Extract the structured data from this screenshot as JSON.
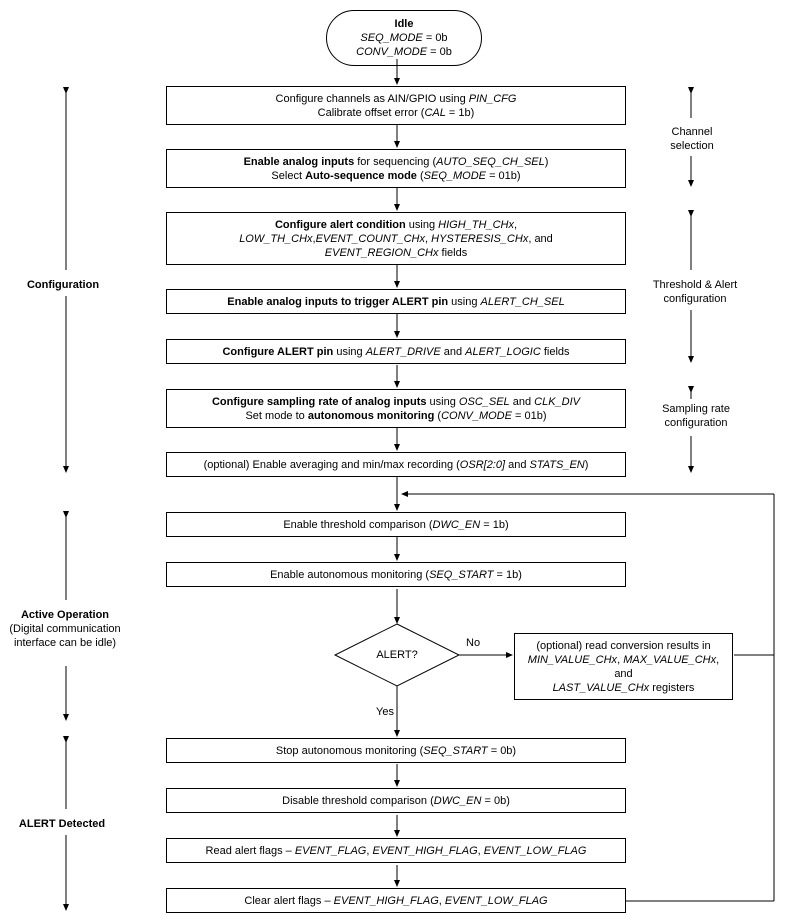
{
  "idle": {
    "title": "Idle",
    "l1": "SEQ_MODE",
    "l2": "CONV_MODE",
    "eq": " = 0b"
  },
  "box1": {
    "t1a": "Configure channels as AIN/GPIO using ",
    "t1b": "PIN_CFG",
    "t2a": "Calibrate offset error (",
    "t2b": "CAL",
    "t2c": " = 1b)"
  },
  "box2": {
    "t1a": "Enable analog inputs",
    "t1b": " for sequencing (",
    "t1c": "AUTO_SEQ_CH_SEL",
    "t1d": ")",
    "t2a": "Select ",
    "t2b": "Auto-sequence mode",
    "t2c": " (",
    "t2d": "SEQ_MODE",
    "t2e": " = 01b)"
  },
  "box3": {
    "t1a": "Configure alert condition",
    "t1b": " using ",
    "t1c": "HIGH_TH_CHx",
    "t1d": ",",
    "t2a": "LOW_TH_CHx",
    "t2b": ",",
    "t2c": "EVENT_COUNT_CHx",
    "t2d": ", ",
    "t2e": "HYSTERESIS_CHx",
    "t2f": ", and",
    "t3a": "EVENT_REGION_CHx",
    "t3b": " fields"
  },
  "box4": {
    "t1a": "Enable analog inputs to trigger ALERT pin",
    "t1b": " using ",
    "t1c": "ALERT_CH_SEL"
  },
  "box5": {
    "t1a": "Configure ALERT pin",
    "t1b": " using ",
    "t1c": "ALERT_DRIVE",
    "t1d": " and ",
    "t1e": "ALERT_LOGIC",
    "t1f": " fields"
  },
  "box6": {
    "t1a": "Configure sampling rate of analog inputs",
    "t1b": " using ",
    "t1c": "OSC_SEL",
    "t1d": " and ",
    "t1e": "CLK_DIV",
    "t2a": "Set mode to ",
    "t2b": "autonomous monitoring",
    "t2c": " (",
    "t2d": "CONV_MODE",
    "t2e": " = 01b)"
  },
  "box7": {
    "t1a": "(optional) Enable averaging and min/max recording (",
    "t1b": "OSR[2:0]",
    "t1c": " and ",
    "t1d": "STATS_EN",
    "t1e": ")"
  },
  "box8": {
    "t1a": "Enable threshold comparison (",
    "t1b": "DWC_EN",
    "t1c": " = 1b)"
  },
  "box9": {
    "t1a": "Enable autonomous monitoring (",
    "t1b": "SEQ_START",
    "t1c": " = 1b)"
  },
  "decision": {
    "label": "ALERT?",
    "yes": "Yes",
    "no": "No"
  },
  "boxOpt": {
    "t1a": "(optional) read conversion results in",
    "t2a": "MIN_VALUE_CHx",
    "t2b": ", ",
    "t2c": "MAX_VALUE_CHx",
    "t2d": ", and",
    "t3a": "LAST_VALUE_CHx",
    "t3b": " registers"
  },
  "box10": {
    "t1a": "Stop autonomous monitoring (",
    "t1b": "SEQ_START",
    "t1c": " = 0b)"
  },
  "box11": {
    "t1a": "Disable threshold comparison (",
    "t1b": "DWC_EN",
    "t1c": " = 0b)"
  },
  "box12": {
    "t1a": "Read alert flags – ",
    "t1b": "EVENT_FLAG",
    "t1c": ", ",
    "t1d": "EVENT_HIGH_FLAG",
    "t1e": ", ",
    "t1f": "EVENT_LOW_FLAG"
  },
  "box13": {
    "t1a": "Clear alert flags – ",
    "t1b": "EVENT_HIGH_FLAG",
    "t1c": ", ",
    "t1d": "EVENT_LOW_FLAG"
  },
  "sections": {
    "configuration": "Configuration",
    "active": "Active Operation",
    "active2": "(Digital communication interface can be idle)",
    "alert": "ALERT Detected"
  },
  "right": {
    "channel": "Channel selection",
    "threshold": "Threshold & Alert configuration",
    "sample": "Sampling rate configuration"
  }
}
